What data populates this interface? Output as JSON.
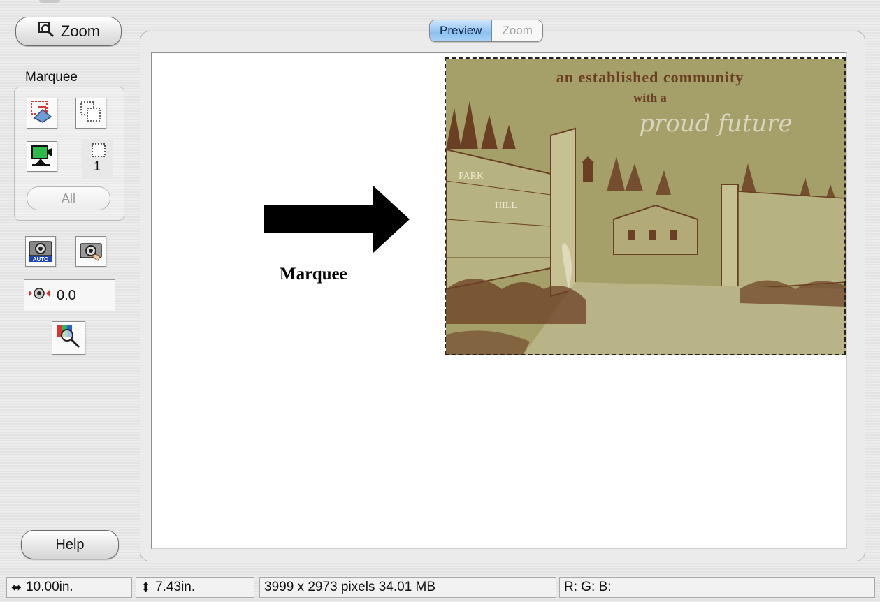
{
  "sidebar": {
    "zoom_label": "Zoom",
    "marquee_label": "Marquee",
    "marquee_count": "1",
    "all_label": "All",
    "exposure_value": "0.0",
    "help_label": "Help"
  },
  "tabs": [
    {
      "label": "Preview",
      "active": true
    },
    {
      "label": "Zoom",
      "active": false
    }
  ],
  "preview": {
    "image_text_line1": "an established community",
    "image_text_line2": "with a",
    "image_text_script": "proud future",
    "sign_park": "PARK",
    "sign_hill": "HILL",
    "annotation_label": "Marquee"
  },
  "status": {
    "width": "10.00in.",
    "height": "7.43in.",
    "pixels": "3999 x 2973 pixels 34.01 MB",
    "rgb": "R: G: B:"
  },
  "colors": {
    "image_background": "#a59f6a",
    "image_ink": "#6b3f24",
    "tab_active": "#8dc0f0"
  }
}
